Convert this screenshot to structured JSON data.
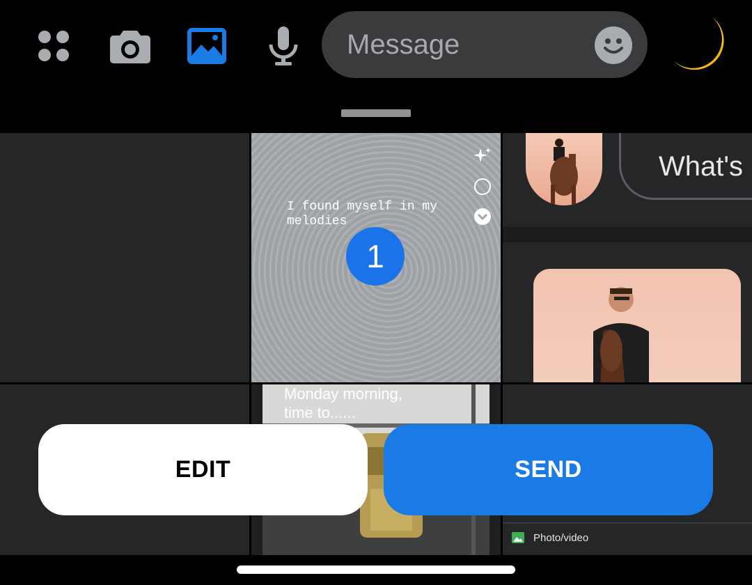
{
  "toolbar": {
    "icons": [
      "apps-icon",
      "camera-icon",
      "gallery-icon",
      "microphone-icon"
    ],
    "accent_color": "#1a7ae6"
  },
  "message": {
    "placeholder": "Message",
    "value": ""
  },
  "gallery": {
    "story_text": "I found myself in my\nmelodies",
    "selection_number": "1",
    "preview_pill_text": "What's",
    "meme_text": "Monday morning,\ntime to......",
    "photo_video_label": "Photo/video"
  },
  "actions": {
    "edit_label": "EDIT",
    "send_label": "SEND"
  }
}
